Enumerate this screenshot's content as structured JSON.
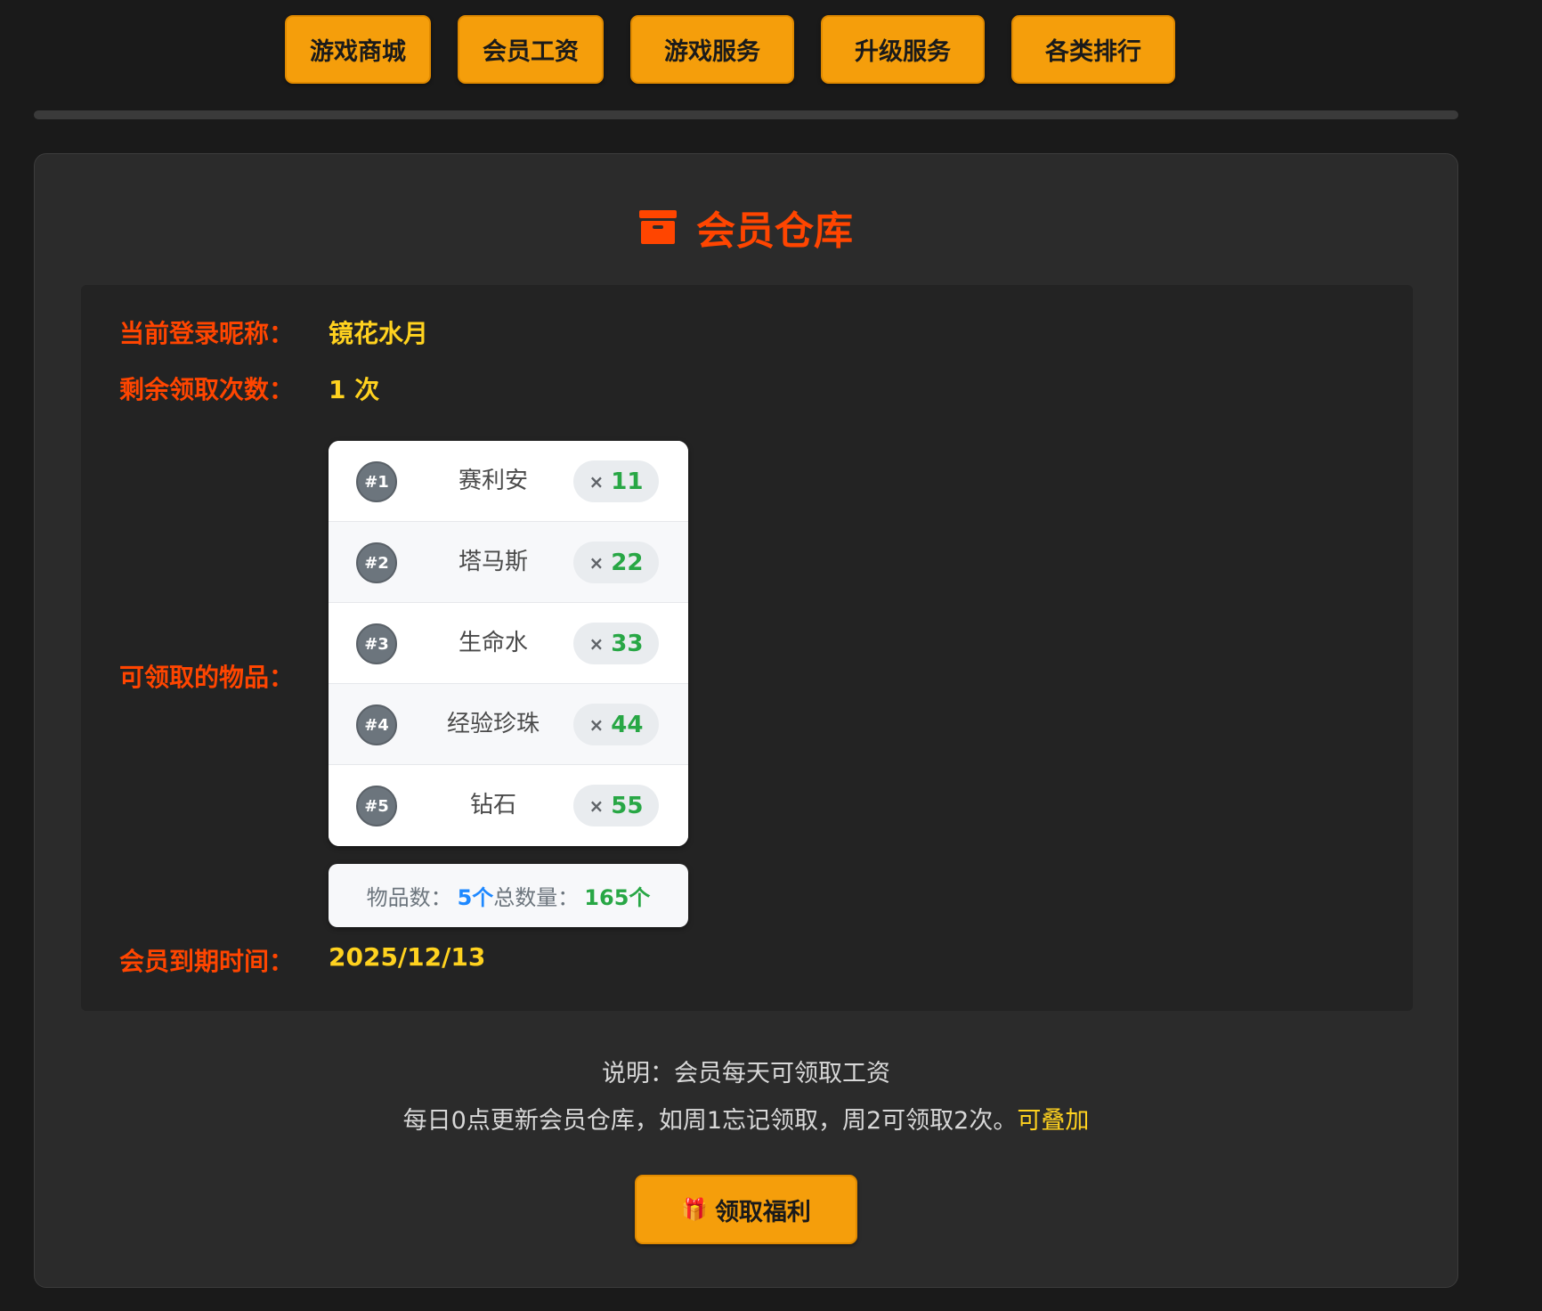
{
  "nav": {
    "items": [
      {
        "label": "游戏商城"
      },
      {
        "label": "会员工资"
      },
      {
        "label": "游戏服务"
      },
      {
        "label": "升级服务"
      },
      {
        "label": "各类排行"
      }
    ]
  },
  "panel": {
    "title": "会员仓库",
    "icon": "box-archive-icon"
  },
  "info": {
    "nickname_label": "当前登录昵称：",
    "nickname": "镜花水月",
    "remaining_label": "剩余领取次数：",
    "remaining": "1 次",
    "items_label": "可领取的物品：",
    "expiry_label": "会员到期时间：",
    "expiry": "2025/12/13"
  },
  "items": [
    {
      "rank": "#1",
      "name": "赛利安",
      "x": "×",
      "qty": "11"
    },
    {
      "rank": "#2",
      "name": "塔马斯",
      "x": "×",
      "qty": "22"
    },
    {
      "rank": "#3",
      "name": "生命水",
      "x": "×",
      "qty": "33"
    },
    {
      "rank": "#4",
      "name": "经验珍珠",
      "x": "×",
      "qty": "44"
    },
    {
      "rank": "#5",
      "name": "钻石",
      "x": "×",
      "qty": "55"
    }
  ],
  "summary": {
    "count_label": "物品数：",
    "count": "5个",
    "total_label": "总数量：",
    "total": "165个"
  },
  "notes": {
    "line1": "说明：会员每天可领取工资",
    "line2": "每日0点更新会员仓库，如周1忘记领取，周2可领取2次。",
    "line2_highlight": "可叠加"
  },
  "claim": {
    "icon": "🎁",
    "label": "领取福利"
  },
  "colors": {
    "accent": "#f59e0b",
    "title": "#ff4500",
    "value": "#ffd21f",
    "qty": "#28a745",
    "count": "#1e88ff"
  }
}
